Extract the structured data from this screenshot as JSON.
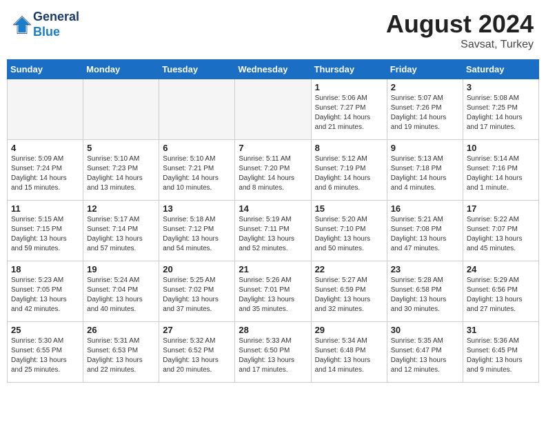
{
  "header": {
    "logo_line1": "General",
    "logo_line2": "Blue",
    "month": "August 2024",
    "location": "Savsat, Turkey"
  },
  "days_of_week": [
    "Sunday",
    "Monday",
    "Tuesday",
    "Wednesday",
    "Thursday",
    "Friday",
    "Saturday"
  ],
  "weeks": [
    [
      {
        "day": "",
        "info": ""
      },
      {
        "day": "",
        "info": ""
      },
      {
        "day": "",
        "info": ""
      },
      {
        "day": "",
        "info": ""
      },
      {
        "day": "1",
        "info": "Sunrise: 5:06 AM\nSunset: 7:27 PM\nDaylight: 14 hours\nand 21 minutes."
      },
      {
        "day": "2",
        "info": "Sunrise: 5:07 AM\nSunset: 7:26 PM\nDaylight: 14 hours\nand 19 minutes."
      },
      {
        "day": "3",
        "info": "Sunrise: 5:08 AM\nSunset: 7:25 PM\nDaylight: 14 hours\nand 17 minutes."
      }
    ],
    [
      {
        "day": "4",
        "info": "Sunrise: 5:09 AM\nSunset: 7:24 PM\nDaylight: 14 hours\nand 15 minutes."
      },
      {
        "day": "5",
        "info": "Sunrise: 5:10 AM\nSunset: 7:23 PM\nDaylight: 14 hours\nand 13 minutes."
      },
      {
        "day": "6",
        "info": "Sunrise: 5:10 AM\nSunset: 7:21 PM\nDaylight: 14 hours\nand 10 minutes."
      },
      {
        "day": "7",
        "info": "Sunrise: 5:11 AM\nSunset: 7:20 PM\nDaylight: 14 hours\nand 8 minutes."
      },
      {
        "day": "8",
        "info": "Sunrise: 5:12 AM\nSunset: 7:19 PM\nDaylight: 14 hours\nand 6 minutes."
      },
      {
        "day": "9",
        "info": "Sunrise: 5:13 AM\nSunset: 7:18 PM\nDaylight: 14 hours\nand 4 minutes."
      },
      {
        "day": "10",
        "info": "Sunrise: 5:14 AM\nSunset: 7:16 PM\nDaylight: 14 hours\nand 1 minute."
      }
    ],
    [
      {
        "day": "11",
        "info": "Sunrise: 5:15 AM\nSunset: 7:15 PM\nDaylight: 13 hours\nand 59 minutes."
      },
      {
        "day": "12",
        "info": "Sunrise: 5:17 AM\nSunset: 7:14 PM\nDaylight: 13 hours\nand 57 minutes."
      },
      {
        "day": "13",
        "info": "Sunrise: 5:18 AM\nSunset: 7:12 PM\nDaylight: 13 hours\nand 54 minutes."
      },
      {
        "day": "14",
        "info": "Sunrise: 5:19 AM\nSunset: 7:11 PM\nDaylight: 13 hours\nand 52 minutes."
      },
      {
        "day": "15",
        "info": "Sunrise: 5:20 AM\nSunset: 7:10 PM\nDaylight: 13 hours\nand 50 minutes."
      },
      {
        "day": "16",
        "info": "Sunrise: 5:21 AM\nSunset: 7:08 PM\nDaylight: 13 hours\nand 47 minutes."
      },
      {
        "day": "17",
        "info": "Sunrise: 5:22 AM\nSunset: 7:07 PM\nDaylight: 13 hours\nand 45 minutes."
      }
    ],
    [
      {
        "day": "18",
        "info": "Sunrise: 5:23 AM\nSunset: 7:05 PM\nDaylight: 13 hours\nand 42 minutes."
      },
      {
        "day": "19",
        "info": "Sunrise: 5:24 AM\nSunset: 7:04 PM\nDaylight: 13 hours\nand 40 minutes."
      },
      {
        "day": "20",
        "info": "Sunrise: 5:25 AM\nSunset: 7:02 PM\nDaylight: 13 hours\nand 37 minutes."
      },
      {
        "day": "21",
        "info": "Sunrise: 5:26 AM\nSunset: 7:01 PM\nDaylight: 13 hours\nand 35 minutes."
      },
      {
        "day": "22",
        "info": "Sunrise: 5:27 AM\nSunset: 6:59 PM\nDaylight: 13 hours\nand 32 minutes."
      },
      {
        "day": "23",
        "info": "Sunrise: 5:28 AM\nSunset: 6:58 PM\nDaylight: 13 hours\nand 30 minutes."
      },
      {
        "day": "24",
        "info": "Sunrise: 5:29 AM\nSunset: 6:56 PM\nDaylight: 13 hours\nand 27 minutes."
      }
    ],
    [
      {
        "day": "25",
        "info": "Sunrise: 5:30 AM\nSunset: 6:55 PM\nDaylight: 13 hours\nand 25 minutes."
      },
      {
        "day": "26",
        "info": "Sunrise: 5:31 AM\nSunset: 6:53 PM\nDaylight: 13 hours\nand 22 minutes."
      },
      {
        "day": "27",
        "info": "Sunrise: 5:32 AM\nSunset: 6:52 PM\nDaylight: 13 hours\nand 20 minutes."
      },
      {
        "day": "28",
        "info": "Sunrise: 5:33 AM\nSunset: 6:50 PM\nDaylight: 13 hours\nand 17 minutes."
      },
      {
        "day": "29",
        "info": "Sunrise: 5:34 AM\nSunset: 6:48 PM\nDaylight: 13 hours\nand 14 minutes."
      },
      {
        "day": "30",
        "info": "Sunrise: 5:35 AM\nSunset: 6:47 PM\nDaylight: 13 hours\nand 12 minutes."
      },
      {
        "day": "31",
        "info": "Sunrise: 5:36 AM\nSunset: 6:45 PM\nDaylight: 13 hours\nand 9 minutes."
      }
    ]
  ]
}
